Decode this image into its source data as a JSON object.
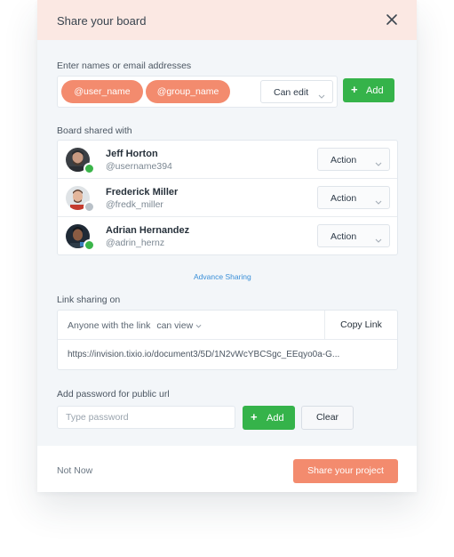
{
  "header": {
    "title": "Share your board"
  },
  "invite": {
    "label": "Enter names or email addresses",
    "tags": [
      "@user_name",
      "@group_name"
    ],
    "permission": "Can edit",
    "add_label": "Add"
  },
  "shared": {
    "label": "Board shared with",
    "users": [
      {
        "name": "Jeff Horton",
        "handle": "@username394",
        "action": "Action",
        "status": "online",
        "status_color": "#3bb54a"
      },
      {
        "name": "Frederick Miller",
        "handle": "@fredk_miller",
        "action": "Action",
        "status": "offline",
        "status_color": "#b9c1c8"
      },
      {
        "name": "Adrian Hernandez",
        "handle": "@adrin_hernz",
        "action": "Action",
        "status": "online",
        "status_color": "#3bb54a"
      }
    ]
  },
  "advanced_link": "Advance Sharing",
  "link_sharing": {
    "label": "Link sharing on",
    "who": "Anyone with the link",
    "permission": "can view",
    "copy_label": "Copy Link",
    "url": "https://invision.tixio.io/document3/5D/1N2vWcYBCSgc_EEqyo0a-G..."
  },
  "password": {
    "label": "Add password for public url",
    "placeholder": "Type password",
    "add_label": "Add",
    "clear_label": "Clear"
  },
  "footer": {
    "not_now": "Not Now",
    "share_label": "Share your project"
  },
  "colors": {
    "accent": "#f38b6e",
    "success": "#35b34a",
    "header_bg": "#fbe8e3",
    "link": "#3a8fd8"
  }
}
